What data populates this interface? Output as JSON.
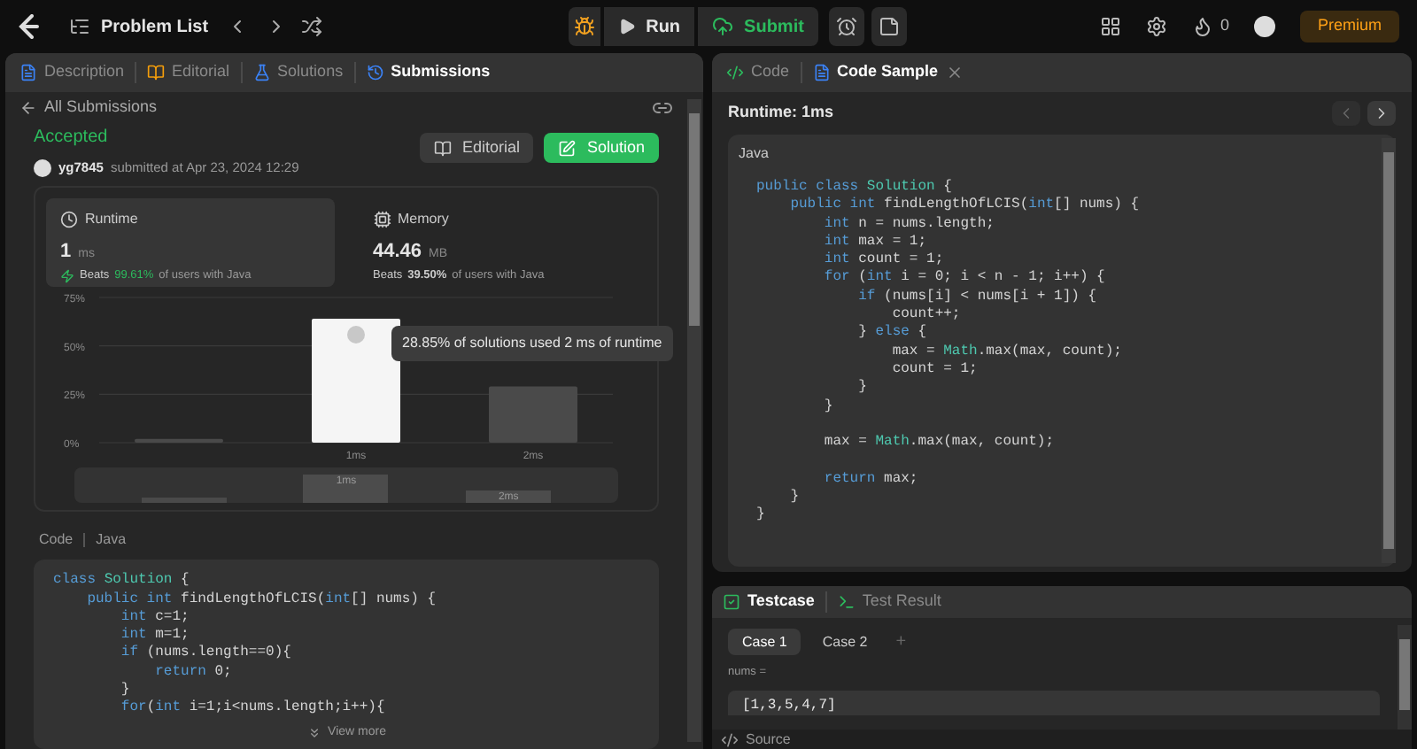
{
  "topbar": {
    "problem_list": "Problem List",
    "run": "Run",
    "submit": "Submit",
    "streak": "0",
    "premium": "Premium"
  },
  "left": {
    "tabs": [
      {
        "label": "Description",
        "selected": false
      },
      {
        "label": "Editorial",
        "selected": false
      },
      {
        "label": "Solutions",
        "selected": false
      },
      {
        "label": "Submissions",
        "selected": true
      }
    ],
    "back": "All Submissions",
    "status": "Accepted",
    "user": "yg7845",
    "submitted": "submitted at Apr 23, 2024 12:29",
    "buttons": [
      {
        "label": "Editorial",
        "kind": "secondary"
      },
      {
        "label": "Solution",
        "kind": "primary"
      }
    ],
    "stats": [
      {
        "title": "Runtime",
        "value": "1",
        "unit": "ms",
        "beats_label": "Beats",
        "beats": "99.61%",
        "suffix": "of users with Java",
        "selected": true
      },
      {
        "title": "Memory",
        "value": "44.46",
        "unit": "MB",
        "beats_label": "Beats",
        "beats": "39.50%",
        "suffix": "of users with Java",
        "selected": false
      }
    ],
    "chart_data": {
      "type": "bar",
      "categories": [
        null,
        "1ms",
        "2ms"
      ],
      "values": [
        2,
        64,
        29
      ],
      "ylim": [
        0,
        75
      ],
      "yticks": [
        {
          "value": 0,
          "label": "0%"
        },
        {
          "value": 25,
          "label": "25%"
        },
        {
          "value": 50,
          "label": "50%"
        },
        {
          "value": 75,
          "label": "75%"
        }
      ]
    },
    "tooltip": "28.85% of solutions used 2 ms of runtime",
    "overview_labels": [
      "1ms",
      "2ms"
    ],
    "code_label": "Code",
    "code_lang": "Java",
    "code": [
      {
        "kind": "code",
        "tokens": [
          {
            "text": "class ",
            "kind": "kw"
          },
          {
            "text": "Solution",
            "kind": "type"
          },
          {
            "text": " {",
            "kind": "plain"
          }
        ]
      },
      {
        "kind": "code",
        "tokens": [
          {
            "text": "    public int ",
            "kind": "kw"
          },
          {
            "text": "findLengthOfLCIS(",
            "kind": "plain"
          },
          {
            "text": "int",
            "kind": "kw"
          },
          {
            "text": "[] nums) {",
            "kind": "plain"
          }
        ]
      },
      {
        "kind": "code",
        "tokens": [
          {
            "text": "        int ",
            "kind": "kw"
          },
          {
            "text": "c=1;",
            "kind": "plain"
          }
        ]
      },
      {
        "kind": "code",
        "tokens": [
          {
            "text": "        int ",
            "kind": "kw"
          },
          {
            "text": "m=1;",
            "kind": "plain"
          }
        ]
      },
      {
        "kind": "code",
        "tokens": [
          {
            "text": "        if ",
            "kind": "kw"
          },
          {
            "text": "(nums.length==0){",
            "kind": "plain"
          }
        ]
      },
      {
        "kind": "code",
        "tokens": [
          {
            "text": "            return ",
            "kind": "kw"
          },
          {
            "text": "0;",
            "kind": "plain"
          }
        ]
      },
      {
        "kind": "code",
        "tokens": [
          {
            "text": "        }",
            "kind": "plain"
          }
        ]
      },
      {
        "kind": "code",
        "tokens": [
          {
            "text": "        for",
            "kind": "kw"
          },
          {
            "text": "(",
            "kind": "plain"
          },
          {
            "text": "int ",
            "kind": "kw"
          },
          {
            "text": "i=1;i<nums.length;i++){",
            "kind": "plain"
          }
        ]
      }
    ],
    "view_more": "View more"
  },
  "right": {
    "tabs": [
      {
        "label": "Code",
        "selected": false,
        "closable": false
      },
      {
        "label": "Code Sample",
        "selected": true,
        "closable": true
      }
    ],
    "runtime": "Runtime: 1ms",
    "lang": "Java",
    "code": [
      {
        "kind": "code",
        "tokens": [
          {
            "text": "public class ",
            "kind": "kw"
          },
          {
            "text": "Solution",
            "kind": "type"
          },
          {
            "text": " {",
            "kind": "plain"
          }
        ]
      },
      {
        "kind": "code",
        "tokens": [
          {
            "text": "    public int ",
            "kind": "kw"
          },
          {
            "text": "findLengthOfLCIS(",
            "kind": "plain"
          },
          {
            "text": "int",
            "kind": "kw"
          },
          {
            "text": "[] nums) {",
            "kind": "plain"
          }
        ]
      },
      {
        "kind": "code",
        "tokens": [
          {
            "text": "        int ",
            "kind": "kw"
          },
          {
            "text": "n = nums.length;",
            "kind": "plain"
          }
        ]
      },
      {
        "kind": "code",
        "tokens": [
          {
            "text": "        int ",
            "kind": "kw"
          },
          {
            "text": "max = 1;",
            "kind": "plain"
          }
        ]
      },
      {
        "kind": "code",
        "tokens": [
          {
            "text": "        int ",
            "kind": "kw"
          },
          {
            "text": "count = 1;",
            "kind": "plain"
          }
        ]
      },
      {
        "kind": "code",
        "tokens": [
          {
            "text": "        for ",
            "kind": "kw"
          },
          {
            "text": "(",
            "kind": "plain"
          },
          {
            "text": "int ",
            "kind": "kw"
          },
          {
            "text": "i = 0; i < n - 1; i++) {",
            "kind": "plain"
          }
        ]
      },
      {
        "kind": "code",
        "tokens": [
          {
            "text": "            if ",
            "kind": "kw"
          },
          {
            "text": "(nums[i] < nums[i + 1]) {",
            "kind": "plain"
          }
        ]
      },
      {
        "kind": "code",
        "tokens": [
          {
            "text": "                count++;",
            "kind": "plain"
          }
        ]
      },
      {
        "kind": "code",
        "tokens": [
          {
            "text": "            } ",
            "kind": "plain"
          },
          {
            "text": "else ",
            "kind": "kw"
          },
          {
            "text": "{",
            "kind": "plain"
          }
        ]
      },
      {
        "kind": "code",
        "tokens": [
          {
            "text": "                max = ",
            "kind": "plain"
          },
          {
            "text": "Math",
            "kind": "type"
          },
          {
            "text": ".max(max, count);",
            "kind": "plain"
          }
        ]
      },
      {
        "kind": "code",
        "tokens": [
          {
            "text": "                count = 1;",
            "kind": "plain"
          }
        ]
      },
      {
        "kind": "code",
        "tokens": [
          {
            "text": "            }",
            "kind": "plain"
          }
        ]
      },
      {
        "kind": "code",
        "tokens": [
          {
            "text": "        }",
            "kind": "plain"
          }
        ]
      },
      {
        "kind": "blank"
      },
      {
        "kind": "code",
        "tokens": [
          {
            "text": "        max = ",
            "kind": "plain"
          },
          {
            "text": "Math",
            "kind": "type"
          },
          {
            "text": ".max(max, count);",
            "kind": "plain"
          }
        ]
      },
      {
        "kind": "blank"
      },
      {
        "kind": "code",
        "tokens": [
          {
            "text": "        return ",
            "kind": "kw"
          },
          {
            "text": "max;",
            "kind": "plain"
          }
        ]
      },
      {
        "kind": "code",
        "tokens": [
          {
            "text": "    }",
            "kind": "plain"
          }
        ]
      },
      {
        "kind": "code",
        "tokens": [
          {
            "text": "}",
            "kind": "plain"
          }
        ]
      }
    ],
    "test_tabs": [
      {
        "label": "Testcase",
        "selected": true
      },
      {
        "label": "Test Result",
        "selected": false
      }
    ],
    "cases": [
      {
        "label": "Case 1",
        "selected": true
      },
      {
        "label": "Case 2",
        "selected": false
      }
    ],
    "add_case": "+",
    "param": "nums =",
    "param_value": "[1,3,5,4,7]",
    "source": "Source"
  }
}
